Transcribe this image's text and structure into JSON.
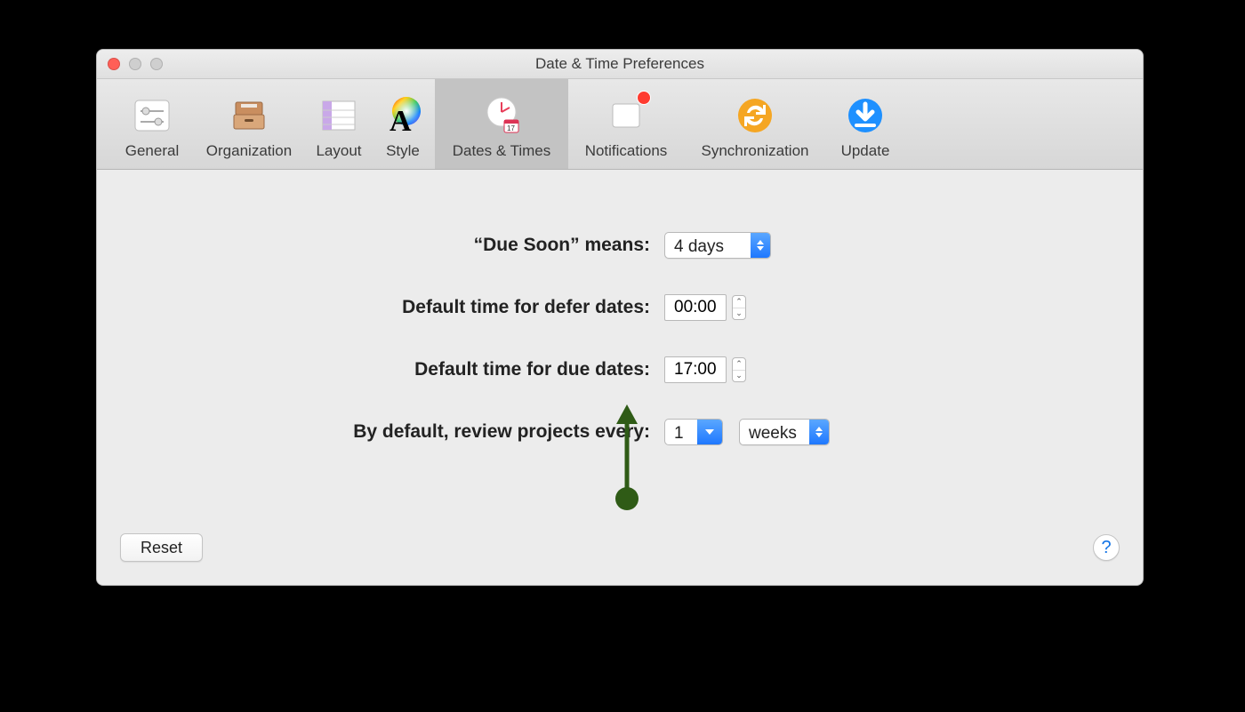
{
  "window": {
    "title": "Date & Time Preferences"
  },
  "toolbar": {
    "tabs": [
      {
        "label": "General"
      },
      {
        "label": "Organization"
      },
      {
        "label": "Layout"
      },
      {
        "label": "Style"
      },
      {
        "label": "Dates & Times"
      },
      {
        "label": "Notifications"
      },
      {
        "label": "Synchronization"
      },
      {
        "label": "Update"
      }
    ]
  },
  "form": {
    "due_soon_label": "“Due Soon” means:",
    "due_soon_value": "4 days",
    "defer_label": "Default time for defer dates:",
    "defer_value": "00:00",
    "due_label": "Default time for due dates:",
    "due_value": "17:00",
    "review_label": "By default, review projects every:",
    "review_count": "1",
    "review_unit": "weeks"
  },
  "footer": {
    "reset_label": "Reset",
    "help_label": "?"
  }
}
